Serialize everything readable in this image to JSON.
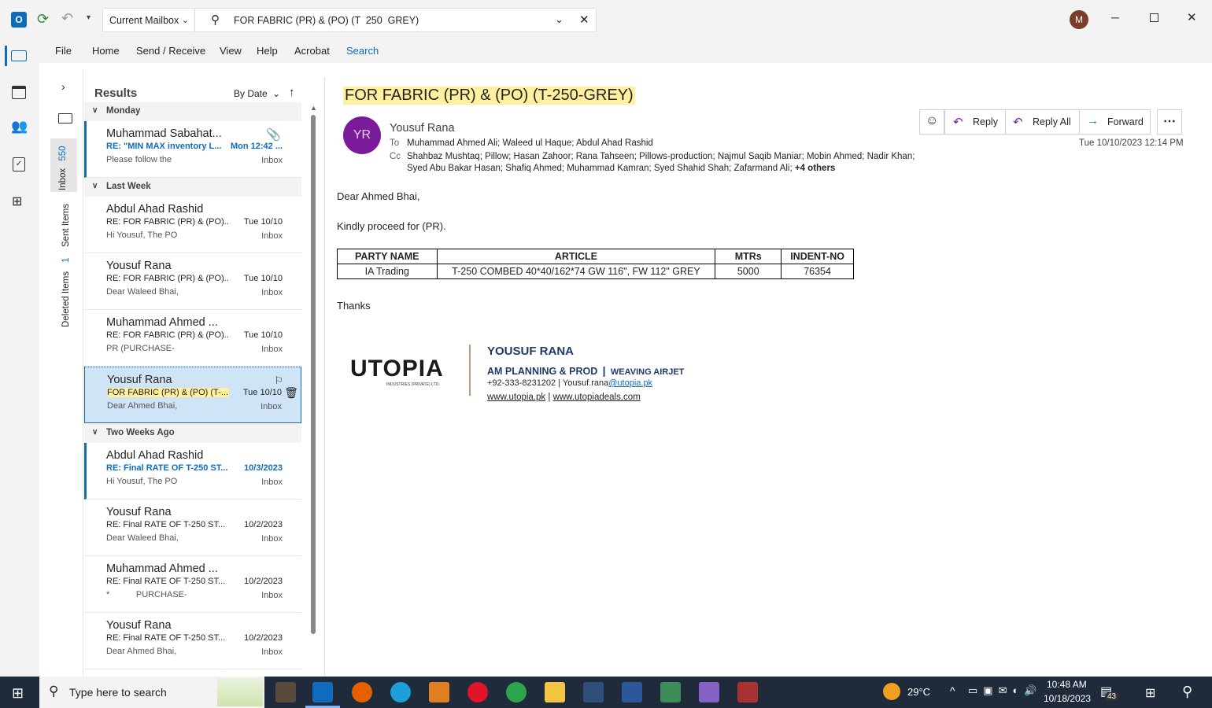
{
  "titlebar": {
    "mailbox": "Current Mailbox",
    "search_query": "FOR FABRIC (PR) & (PO) (T  250  GREY)",
    "avatar": "M"
  },
  "ribbon": {
    "tabs": [
      "File",
      "Home",
      "Send / Receive",
      "View",
      "Help",
      "Acrobat",
      "Search"
    ]
  },
  "folders": {
    "inbox": "Inbox",
    "inbox_count": "550",
    "sent": "Sent Items",
    "deleted": "Deleted Items",
    "deleted_count": "1"
  },
  "results": {
    "title": "Results",
    "sort": "By Date",
    "groups": {
      "monday": "Monday",
      "last_week": "Last Week",
      "two_weeks": "Two Weeks Ago"
    },
    "messages": [
      {
        "from": "Muhammad Sabahat...",
        "subject": "RE: \"MIN MAX inventory L...",
        "preview": "Please follow the",
        "date": "Mon 12:42 ...",
        "folder": "Inbox"
      },
      {
        "from": "Abdul Ahad Rashid",
        "subject": "RE: FOR FABRIC (PR) & (PO)...",
        "preview": "Hi Yousuf,  The PO",
        "date": "Tue 10/10",
        "folder": "Inbox"
      },
      {
        "from": "Yousuf Rana",
        "subject": "RE: FOR FABRIC (PR) & (PO)...",
        "preview": "Dear Waleed Bhai,",
        "date": "Tue 10/10",
        "folder": "Inbox"
      },
      {
        "from": "Muhammad Ahmed ...",
        "subject": "RE: FOR FABRIC (PR) & (PO)...",
        "preview": "PR (PURCHASE-",
        "date": "Tue 10/10",
        "folder": "Inbox"
      },
      {
        "from": "Yousuf Rana",
        "subject": "FOR FABRIC (PR) & (PO) (T-...",
        "preview": "Dear Ahmed Bhai,",
        "date": "Tue 10/10",
        "folder": "Inbox"
      },
      {
        "from": "Abdul Ahad Rashid",
        "subject": "RE: Final RATE OF T-250 ST...",
        "preview": "Hi Yousuf,  The PO",
        "date": "10/3/2023",
        "folder": "Inbox"
      },
      {
        "from": "Yousuf Rana",
        "subject": "RE: Final RATE OF T-250 ST...",
        "preview": "Dear Waleed Bhai,",
        "date": "10/2/2023",
        "folder": "Inbox"
      },
      {
        "from": "Muhammad Ahmed ...",
        "subject": "RE: Final RATE OF T-250 ST...",
        "preview": "*           PURCHASE-",
        "date": "10/2/2023",
        "folder": "Inbox"
      },
      {
        "from": "Yousuf Rana",
        "subject": "RE: Final RATE OF T-250 ST...",
        "preview": "Dear Ahmed Bhai,",
        "date": "10/2/2023",
        "folder": "Inbox"
      }
    ]
  },
  "email": {
    "subject": "FOR FABRIC (PR) & (PO) (T-250-GREY)",
    "sender_initials": "YR",
    "sender": "Yousuf Rana",
    "to_label": "To",
    "to": "Muhammad Ahmed Ali; Waleed ul Haque; Abdul Ahad Rashid",
    "cc_label": "Cc",
    "cc_line1": "Shahbaz Mushtaq; Pillow; Hasan Zahoor; Rana Tahseen; Pillows-production; Najmul Saqib Maniar; Mobin Ahmed; Nadir Khan;",
    "cc_line2": "Syed Abu Bakar Hasan; Shafiq Ahmed; Muhammad Kamran; Syed Shahid Shah; Zafarmand  Ali;",
    "cc_more": "+4 others",
    "datetime": "Tue 10/10/2023 12:14 PM",
    "actions": {
      "reply": "Reply",
      "reply_all": "Reply All",
      "forward": "Forward"
    },
    "greeting": "Dear Ahmed Bhai,",
    "body_line": "Kindly proceed for (PR).",
    "table": {
      "headers": [
        "PARTY NAME",
        "ARTICLE",
        "MTRs",
        "INDENT-NO"
      ],
      "row": [
        "IA Trading",
        "T-250 COMBED 40*40/162*74 GW 116\", FW 112\" GREY",
        "5000",
        "76354"
      ]
    },
    "closing": "Thanks",
    "signature": {
      "logo_text": "UTOPIA",
      "logo_sub": "INDUSTRIES (PRIVATE) LTD.",
      "name": "YOUSUF RANA",
      "title": "AM PLANNING & PROD",
      "title_sep": "|",
      "dept": "WEAVING AIRJET",
      "phone": "+92-333-8231202 | Yousuf.rana",
      "email_domain": "@utopia.pk",
      "site1": "www.utopia.pk",
      "site_sep": "|",
      "site2": "www.utopiadeals.com"
    }
  },
  "taskbar": {
    "search_placeholder": "Type here to search",
    "weather": "29°C",
    "time": "10:48 AM",
    "date": "10/18/2023",
    "notif_count": "43"
  },
  "colors": {
    "accent": "#0f6cbd",
    "highlight": "#fff0a0",
    "selected": "#cfe4f7",
    "avatar": "#7a1c99"
  }
}
